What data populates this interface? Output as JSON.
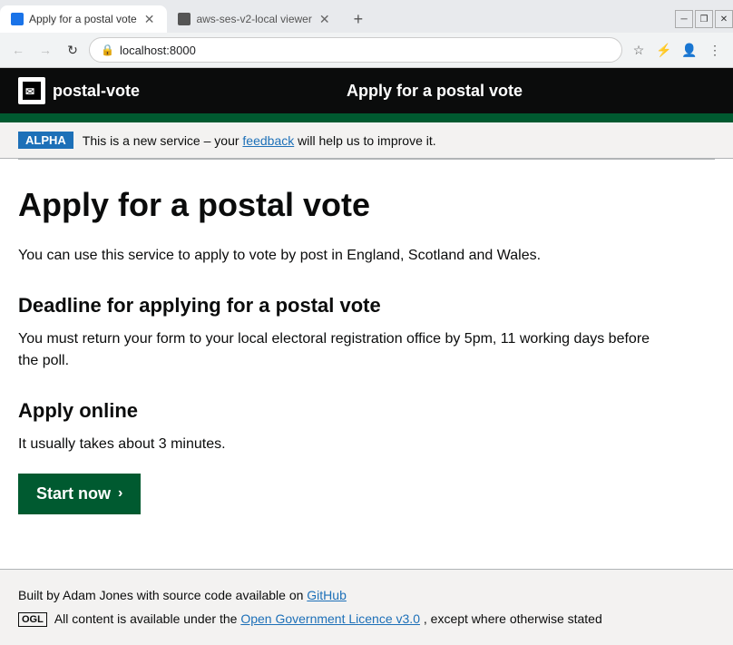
{
  "browser": {
    "tabs": [
      {
        "id": "tab1",
        "title": "Apply for a postal vote",
        "active": true
      },
      {
        "id": "tab2",
        "title": "aws-ses-v2-local viewer",
        "active": false
      }
    ],
    "address": "localhost:8000",
    "new_tab_label": "+"
  },
  "header": {
    "logo_text": "postal-vote",
    "title": "Apply for a postal vote"
  },
  "alpha_banner": {
    "badge": "ALPHA",
    "text_before": "This is a new service – your",
    "link": "feedback",
    "text_after": "will help us to improve it."
  },
  "main": {
    "page_heading": "Apply for a postal vote",
    "intro_text": "You can use this service to apply to vote by post in England, Scotland and Wales.",
    "sections": [
      {
        "heading": "Deadline for applying for a postal vote",
        "text": "You must return your form to your local electoral registration office by 5pm, 11 working days before the poll."
      },
      {
        "heading": "Apply online",
        "text": "It usually takes about 3 minutes."
      }
    ],
    "start_button_label": "Start now"
  },
  "footer": {
    "built_by_text": "Built by Adam Jones with source code available on",
    "built_by_link": "GitHub",
    "ogl_logo": "OGL",
    "ogl_text": "All content is available under the",
    "ogl_link": "Open Government Licence v3.0",
    "ogl_suffix": ", except where otherwise stated"
  }
}
